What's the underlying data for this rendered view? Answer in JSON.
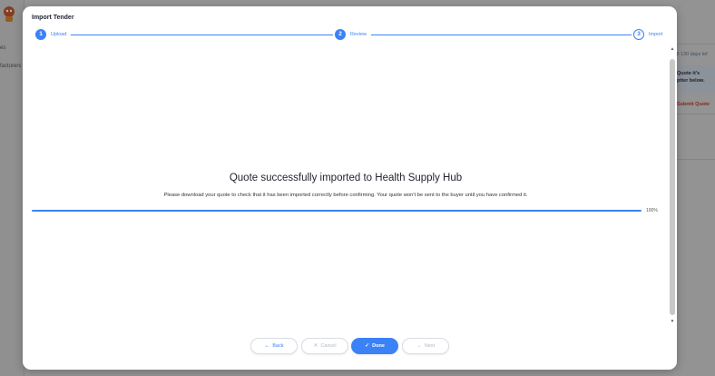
{
  "background": {
    "sidebar_items": [
      "es",
      "facturers"
    ],
    "right_texts": [
      "il 130 days lef",
      "Quote it's",
      "ptter below.",
      "Submit Quote"
    ]
  },
  "modal": {
    "title": "Import Tender",
    "steps": [
      {
        "number": "1",
        "label": "Upload",
        "state": "done"
      },
      {
        "number": "2",
        "label": "Review",
        "state": "done"
      },
      {
        "number": "3",
        "label": "Import",
        "state": "current"
      }
    ],
    "headline": "Quote successfully imported to Health Supply Hub",
    "subtext": "Please download your quote to check that it has been imported correctly before confirming. Your quote won't be sent to the buyer until you have confirmed it.",
    "progress": {
      "value_percent": 100,
      "label": "100%"
    },
    "buttons": {
      "back": {
        "label": "Back",
        "icon": "arrow-left-icon",
        "glyph": "←"
      },
      "cancel": {
        "label": "Cancel",
        "icon": "close-icon",
        "glyph": "✕"
      },
      "done": {
        "label": "Done",
        "icon": "check-icon",
        "glyph": "✓"
      },
      "next": {
        "label": "Next",
        "icon": "arrow-right-icon",
        "glyph": "→"
      }
    }
  },
  "colors": {
    "accent": "#3b82f6",
    "disabled": "#b4b8bf",
    "warning": "#b8402e"
  }
}
